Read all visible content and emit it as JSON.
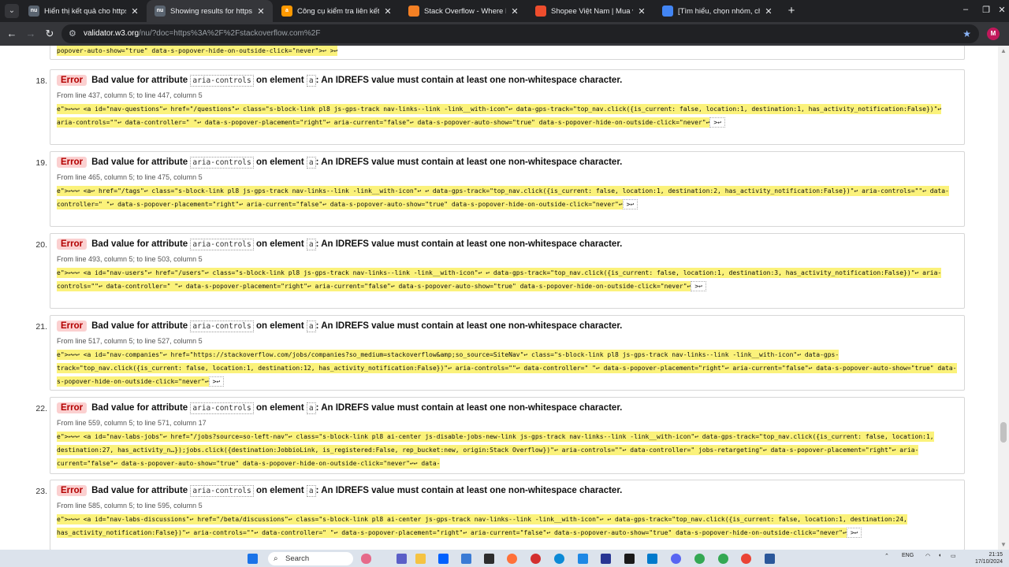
{
  "browser": {
    "tabs": [
      {
        "icon": "nu-icon",
        "fav_text": "nu",
        "title": "Hiển thị kết quả cho https://ahi",
        "active": false
      },
      {
        "icon": "nu-icon",
        "fav_text": "nu",
        "title": "Showing results for https://stac",
        "active": true
      },
      {
        "icon": "amazon-icon",
        "fav_text": "a",
        "title": "Công cụ kiểm tra liên kết hỏng",
        "active": false
      },
      {
        "icon": "stackoverflow-icon",
        "fav_text": "",
        "title": "Stack Overflow - Where Develo",
        "active": false
      },
      {
        "icon": "shopee-icon",
        "fav_text": "",
        "title": "Shopee Việt Nam | Mua và Bán",
        "active": false
      },
      {
        "icon": "doc-icon",
        "fav_text": "",
        "title": "[Tìm hiểu, chọn nhóm, chọn đi",
        "active": false
      }
    ],
    "close_glyph": "✕",
    "new_tab_glyph": "+",
    "url_host": "validator.w3.org",
    "url_path": "/nu/?doc=https%3A%2F%2Fstackoverflow.com%2F",
    "profile_initial": "M"
  },
  "top_fragment": "popover-auto-show=\"true\" data-s-popover-hide-on-outside-click=\"never\">↩        >↩",
  "messages": [
    {
      "num": "18.",
      "badge": "Error",
      "bad_value": "Bad value",
      "for_attribute": "for attribute",
      "attr": "aria-controls",
      "on_element": "on element",
      "element": "a",
      "message": ": An IDREFS value must contain at least one non-whitespace character.",
      "location": "From line 437, column 5; to line 447, column 5",
      "code": "e\">↩↩↩    <a id=\"nav-questions\"↩        href=\"/questions\"↩        class=\"s-block-link pl8 js-gps-track nav-links--link -link__with-icon\"↩        data-gps-track=\"top_nav.click({is_current: false, location:1, destination:1,  has_activity_notification:False})\"↩        aria-controls=\"\"↩        data-controller=\" \"↩        data-s-popover-placement=\"right\"↩        aria-current=\"false\"↩        data-s-popover-auto-show=\"true\" data-s-popover-hide-on-outside-click=\"never\"↩",
      "tail": ">↩"
    },
    {
      "num": "19.",
      "badge": "Error",
      "bad_value": "Bad value",
      "for_attribute": "for attribute",
      "attr": "aria-controls",
      "on_element": "on element",
      "element": "a",
      "message": ": An IDREFS value must contain at least one non-whitespace character.",
      "location": "From line 465, column 5; to line 475, column 5",
      "code": "e\">↩↩↩    <a↩        href=\"/tags\"↩        class=\"s-block-link pl8 js-gps-track nav-links--link -link__with-icon\"↩        ↩        data-gps-track=\"top_nav.click({is_current: false, location:1, destination:2, has_activity_notification:False})\"↩        aria-controls=\"\"↩        data-controller=\" \"↩        data-s-popover-placement=\"right\"↩        aria-current=\"false\"↩        data-s-popover-auto-show=\"true\" data-s-popover-hide-on-outside-click=\"never\"↩",
      "tail": ">↩"
    },
    {
      "num": "20.",
      "badge": "Error",
      "bad_value": "Bad value",
      "for_attribute": "for attribute",
      "attr": "aria-controls",
      "on_element": "on element",
      "element": "a",
      "message": ": An IDREFS value must contain at least one non-whitespace character.",
      "location": "From line 493, column 5; to line 503, column 5",
      "code": "e\">↩↩↩    <a id=\"nav-users\"↩        href=\"/users\"↩        class=\"s-block-link pl8 js-gps-track nav-links--link -link__with-icon\"↩        ↩        data-gps-track=\"top_nav.click({is_current: false, location:1, destination:3,  has_activity_notification:False})\"↩        aria-controls=\"\"↩        data-controller=\" \"↩        data-s-popover-placement=\"right\"↩        aria-current=\"false\"↩        data-s-popover-auto-show=\"true\" data-s-popover-hide-on-outside-click=\"never\"↩",
      "tail": ">↩"
    },
    {
      "num": "21.",
      "badge": "Error",
      "bad_value": "Bad value",
      "for_attribute": "for attribute",
      "attr": "aria-controls",
      "on_element": "on element",
      "element": "a",
      "message": ": An IDREFS value must contain at least one non-whitespace character.",
      "location": "From line 517, column 5; to line 527, column 5",
      "code": "e\">↩↩↩    <a id=\"nav-companies\"↩        href=\"https://stackoverflow.com/jobs/companies?so_medium=stackoverflow&amp;so_source=SiteNav\"↩        class=\"s-block-link pl8 js-gps-track nav-links--link -link__with-icon\"↩        data-gps-track=\"top_nav.click({is_current: false, location:1, destination:12,  has_activity_notification:False})\"↩        aria-controls=\"\"↩        data-controller=\" \"↩        data-s-popover-placement=\"right\"↩        aria-current=\"false\"↩        data-s-popover-auto-show=\"true\" data-s-popover-hide-on-outside-click=\"never\"↩",
      "tail": ">↩"
    },
    {
      "num": "22.",
      "badge": "Error",
      "bad_value": "Bad value",
      "for_attribute": "for attribute",
      "attr": "aria-controls",
      "on_element": "on element",
      "element": "a",
      "message": ": An IDREFS value must contain at least one non-whitespace character.",
      "location": "From line 559, column 5; to line 571, column 17",
      "code": "e\">↩↩↩    <a id=\"nav-labs-jobs\"↩        href=\"/jobs?source=so-left-nav\"↩        class=\"s-block-link pl8 ai-center js-disable-jobs-new-link js-gps-track nav-links--link -link__with-icon\"↩        data-gps-track=\"top_nav.click({is_current: false, location:1, destination:27,  has_activity_n…});jobs.click({destination:JobbioLink, is_registered:False, rep_bucket:new, origin:Stack Overflow})\"↩        aria-controls=\"\"↩        data-controller=\" jobs-retargeting\"↩        data-s-popover-placement=\"right\"↩        aria-current=\"false\"↩        data-s-popover-auto-show=\"true\" data-s-popover-hide-on-outside-click=\"never\"↩↩        data-",
      "tail": ""
    },
    {
      "num": "23.",
      "badge": "Error",
      "bad_value": "Bad value",
      "for_attribute": "for attribute",
      "attr": "aria-controls",
      "on_element": "on element",
      "element": "a",
      "message": ": An IDREFS value must contain at least one non-whitespace character.",
      "location": "From line 585, column 5; to line 595, column 5",
      "code": "e\">↩↩↩    <a id=\"nav-labs-discussions\"↩        href=\"/beta/discussions\"↩        class=\"s-block-link pl8 ai-center js-gps-track nav-links--link -link__with-icon\"↩        ↩        data-gps-track=\"top_nav.click({is_current: false, location:1, destination:24,  has_activity_notification:False})\"↩        aria-controls=\"\"↩        data-controller=\" \"↩        data-s-popover-placement=\"right\"↩        aria-current=\"false\"↩        data-s-popover-auto-show=\"true\" data-s-popover-hide-on-outside-click=\"never\"↩",
      "tail": ">↩"
    }
  ],
  "taskbar": {
    "search_placeholder": "Search",
    "lang": "ENG",
    "time": "21:15",
    "date": "17/10/2024"
  },
  "colors": {
    "error_badge_bg": "#fbd0d0",
    "error_badge_text": "#b30000",
    "code_highlight": "#fbf27b",
    "chrome_dark": "#202124"
  }
}
